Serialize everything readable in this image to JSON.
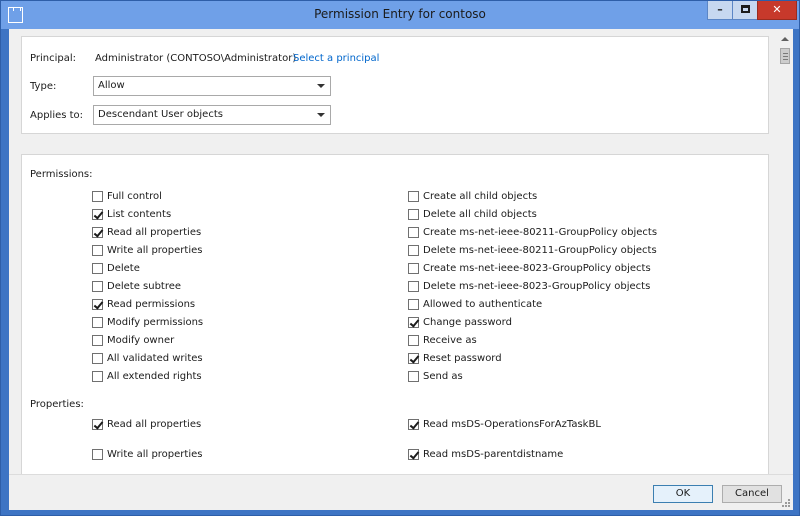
{
  "window": {
    "title": "Permission Entry for contoso",
    "minimize_glyph": "–",
    "close_glyph": "✕"
  },
  "principal": {
    "label": "Principal:",
    "value": "Administrator (CONTOSO\\Administrator)",
    "link": "Select a principal"
  },
  "type": {
    "label": "Type:",
    "value": "Allow"
  },
  "applies_to": {
    "label": "Applies to:",
    "value": "Descendant User objects"
  },
  "permissions": {
    "label": "Permissions:",
    "left": [
      {
        "label": "Full control",
        "checked": false
      },
      {
        "label": "List contents",
        "checked": true
      },
      {
        "label": "Read all properties",
        "checked": true
      },
      {
        "label": "Write all properties",
        "checked": false
      },
      {
        "label": "Delete",
        "checked": false
      },
      {
        "label": "Delete subtree",
        "checked": false
      },
      {
        "label": "Read permissions",
        "checked": true
      },
      {
        "label": "Modify permissions",
        "checked": false
      },
      {
        "label": "Modify owner",
        "checked": false
      },
      {
        "label": "All validated writes",
        "checked": false
      },
      {
        "label": "All extended rights",
        "checked": false
      }
    ],
    "right": [
      {
        "label": "Create all child objects",
        "checked": false
      },
      {
        "label": "Delete all child objects",
        "checked": false
      },
      {
        "label": "Create ms-net-ieee-80211-GroupPolicy objects",
        "checked": false
      },
      {
        "label": "Delete ms-net-ieee-80211-GroupPolicy objects",
        "checked": false
      },
      {
        "label": "Create ms-net-ieee-8023-GroupPolicy objects",
        "checked": false
      },
      {
        "label": "Delete ms-net-ieee-8023-GroupPolicy objects",
        "checked": false
      },
      {
        "label": "Allowed to authenticate",
        "checked": false
      },
      {
        "label": "Change password",
        "checked": true
      },
      {
        "label": "Receive as",
        "checked": false
      },
      {
        "label": "Reset password",
        "checked": true
      },
      {
        "label": "Send as",
        "checked": false
      }
    ]
  },
  "properties": {
    "label": "Properties:",
    "left": [
      {
        "label": "Read all properties",
        "checked": true
      },
      {
        "label": "Write all properties",
        "checked": false
      }
    ],
    "right": [
      {
        "label": "Read msDS-OperationsForAzTaskBL",
        "checked": true
      },
      {
        "label": "Read msDS-parentdistname",
        "checked": true
      }
    ]
  },
  "buttons": {
    "ok": "OK",
    "cancel": "Cancel"
  },
  "icons": {
    "app": "folder-icon",
    "minimize": "minimize-icon",
    "maximize": "maximize-icon",
    "close": "close-icon",
    "dropdown": "chevron-down-icon",
    "checkbox": "checkmark-icon",
    "scroll_up": "arrow-up-icon",
    "resize": "resize-grip-icon"
  },
  "colors": {
    "title_bar": "#6fa0e8",
    "window_frame": "#3d74c4",
    "close_button": "#c7392b",
    "link": "#0066cc"
  }
}
